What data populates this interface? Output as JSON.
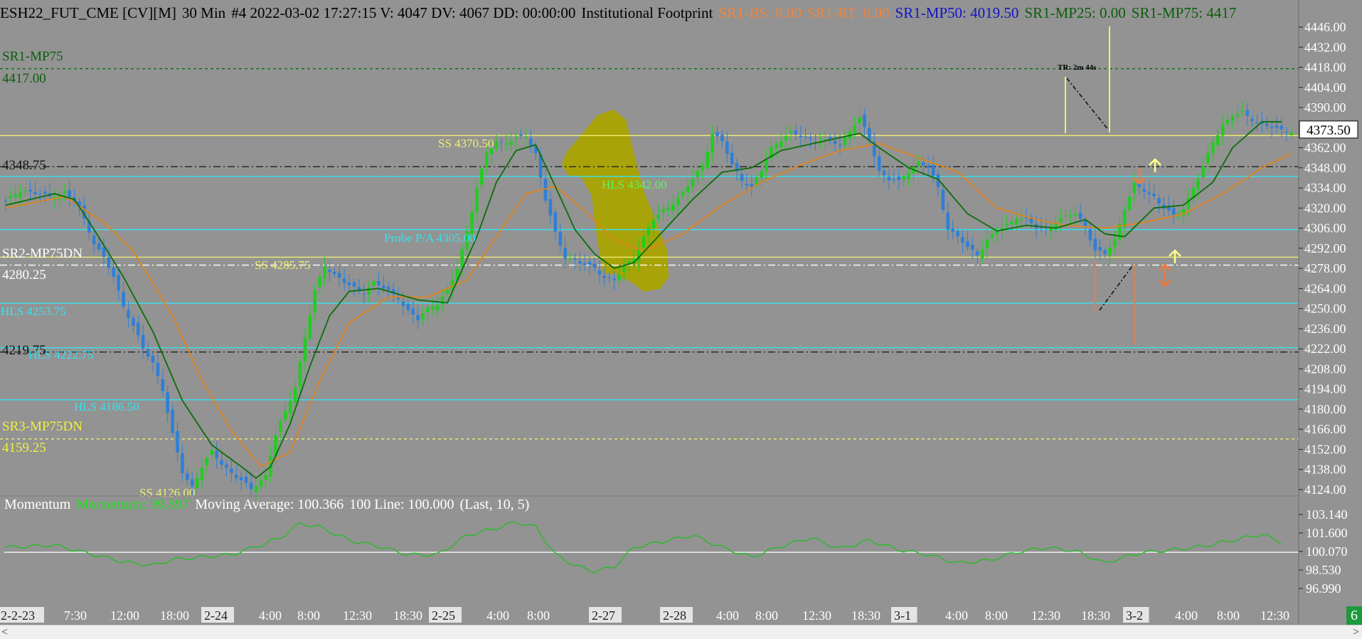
{
  "header": {
    "symbol": "ESH22_FUT_CME [CV][M]",
    "interval": "30 Min",
    "bar_info": "#4 2022-03-02 17:27:15 V: 4047 DV: 4067 DD: 00:00:00",
    "study": "Institutional Footprint",
    "sr1_bs": "SR1-BS: 0.00",
    "sr1_rt": "SR1-RT: 0.00",
    "sr1_mp50": "SR1-MP50: 4019.50",
    "sr1_mp25": "SR1-MP25: 0.00",
    "sr1_mp75": "SR1-MP75: 4417"
  },
  "colors": {
    "background": "#939393",
    "candle_up": "#22cc22",
    "candle_down": "#2f7fd6",
    "fast_ma": "#0b6e0b",
    "slow_ma": "#e0841c",
    "cyan_line": "#35e3f0",
    "yellow_line": "#f0f070",
    "highlight": "#a9a300",
    "orange_arrow": "#f07a3a",
    "yellow_arrow": "#ffff8a",
    "momentum_line": "#1fbf1f"
  },
  "price_axis": {
    "ticks": [
      "4446.00",
      "4432.00",
      "4418.00",
      "4404.00",
      "4390.00",
      "4376.00",
      "4362.00",
      "4348.00",
      "4334.00",
      "4320.00",
      "4306.00",
      "4292.00",
      "4278.00",
      "4264.00",
      "4250.00",
      "4236.00",
      "4222.00",
      "4208.00",
      "4194.00",
      "4180.00",
      "4166.00",
      "4152.00",
      "4138.00",
      "4124.00"
    ],
    "current": "4373.50"
  },
  "momentum_axis": {
    "ticks": [
      "103.140",
      "101.600",
      "100.070",
      "98.530",
      "96.990"
    ]
  },
  "time_axis": {
    "labels": [
      {
        "t": "2-2-23",
        "sep": true
      },
      {
        "t": "7:30"
      },
      {
        "t": "12:00"
      },
      {
        "t": "18:00"
      },
      {
        "t": "2-24",
        "sep": true
      },
      {
        "t": "4:00"
      },
      {
        "t": "8:00"
      },
      {
        "t": "12:30"
      },
      {
        "t": "18:30"
      },
      {
        "t": "2-25",
        "sep": true
      },
      {
        "t": "4:00"
      },
      {
        "t": "8:00"
      },
      {
        "t": "2-27",
        "sep": true
      },
      {
        "t": "2-28",
        "sep": true
      },
      {
        "t": "4:00"
      },
      {
        "t": "8:00"
      },
      {
        "t": "12:30"
      },
      {
        "t": "18:30"
      },
      {
        "t": "3-1",
        "sep": true
      },
      {
        "t": "4:00"
      },
      {
        "t": "8:00"
      },
      {
        "t": "12:30"
      },
      {
        "t": "18:30"
      },
      {
        "t": "3-2",
        "sep": true
      },
      {
        "t": "4:00"
      },
      {
        "t": "8:00"
      },
      {
        "t": "12:30"
      }
    ]
  },
  "level_labels": {
    "sr1_name": "SR1-MP75",
    "sr1_value": "4417.00",
    "pivot_value": "4348.75",
    "sr2_name": "SR2-MP75DN",
    "sr2_value": "4280.25",
    "low_pivot": "4219.75",
    "sr3_name": "SR3-MP75DN",
    "sr3_value": "4159.25",
    "ss1": "SS 4370.50",
    "hls_mid": "HLS 4342.00",
    "probe": "Probe P/A 4305.00",
    "ss2": "SS 4285.75",
    "hls1": "HLS 4253.75",
    "hls2": "HLS 4222.75",
    "hls3": "HLS 4186.50",
    "ss3": "SS 4126.00",
    "tr": "TR: 2m 44s"
  },
  "momentum": {
    "name": "Momentum",
    "value": "Momentum: 99.897",
    "ma": "Moving Average: 100.366",
    "line100": "100 Line: 100.000",
    "params": "(Last, 10, 5)"
  },
  "corner_badge": "6",
  "chart_data": {
    "type": "candlestick",
    "title": "ESH22_FUT_CME [CV][M] 30 Min",
    "ylim": [
      4124,
      4446
    ],
    "anchors": [
      [
        0,
        4324
      ],
      [
        3,
        4333
      ],
      [
        6,
        4330
      ],
      [
        9,
        4328
      ],
      [
        12,
        4331
      ],
      [
        15,
        4320
      ],
      [
        18,
        4296
      ],
      [
        20,
        4285
      ],
      [
        22,
        4272
      ],
      [
        24,
        4252
      ],
      [
        26,
        4238
      ],
      [
        28,
        4222
      ],
      [
        30,
        4212
      ],
      [
        32,
        4194
      ],
      [
        34,
        4162
      ],
      [
        36,
        4136
      ],
      [
        38,
        4126
      ],
      [
        40,
        4140
      ],
      [
        42,
        4150
      ],
      [
        44,
        4142
      ],
      [
        46,
        4136
      ],
      [
        48,
        4130
      ],
      [
        50,
        4124
      ],
      [
        53,
        4134
      ],
      [
        55,
        4162
      ],
      [
        57,
        4178
      ],
      [
        59,
        4196
      ],
      [
        61,
        4230
      ],
      [
        63,
        4262
      ],
      [
        65,
        4280
      ],
      [
        67,
        4274
      ],
      [
        69,
        4268
      ],
      [
        71,
        4264
      ],
      [
        73,
        4262
      ],
      [
        75,
        4268
      ],
      [
        78,
        4262
      ],
      [
        80,
        4258
      ],
      [
        82,
        4248
      ],
      [
        84,
        4242
      ],
      [
        86,
        4250
      ],
      [
        88,
        4254
      ],
      [
        90,
        4262
      ],
      [
        92,
        4278
      ],
      [
        94,
        4304
      ],
      [
        96,
        4334
      ],
      [
        98,
        4358
      ],
      [
        100,
        4366
      ],
      [
        102,
        4366
      ],
      [
        104,
        4368
      ],
      [
        106,
        4370
      ],
      [
        108,
        4358
      ],
      [
        110,
        4326
      ],
      [
        112,
        4302
      ],
      [
        114,
        4286
      ],
      [
        116,
        4284
      ],
      [
        118,
        4280
      ],
      [
        120,
        4278
      ],
      [
        122,
        4272
      ],
      [
        124,
        4270
      ],
      [
        126,
        4278
      ],
      [
        128,
        4286
      ],
      [
        130,
        4300
      ],
      [
        132,
        4312
      ],
      [
        134,
        4318
      ],
      [
        136,
        4324
      ],
      [
        138,
        4330
      ],
      [
        140,
        4340
      ],
      [
        142,
        4350
      ],
      [
        144,
        4372
      ],
      [
        146,
        4366
      ],
      [
        148,
        4350
      ],
      [
        150,
        4340
      ],
      [
        152,
        4334
      ],
      [
        154,
        4346
      ],
      [
        156,
        4362
      ],
      [
        158,
        4368
      ],
      [
        160,
        4372
      ],
      [
        162,
        4370
      ],
      [
        164,
        4368
      ],
      [
        166,
        4366
      ],
      [
        168,
        4367
      ],
      [
        170,
        4364
      ],
      [
        172,
        4374
      ],
      [
        174,
        4382
      ],
      [
        176,
        4368
      ],
      [
        178,
        4346
      ],
      [
        180,
        4340
      ],
      [
        182,
        4338
      ],
      [
        184,
        4346
      ],
      [
        186,
        4352
      ],
      [
        188,
        4348
      ],
      [
        190,
        4334
      ],
      [
        192,
        4306
      ],
      [
        194,
        4300
      ],
      [
        196,
        4292
      ],
      [
        198,
        4288
      ],
      [
        200,
        4298
      ],
      [
        202,
        4304
      ],
      [
        204,
        4308
      ],
      [
        206,
        4314
      ],
      [
        208,
        4312
      ],
      [
        210,
        4306
      ],
      [
        212,
        4306
      ],
      [
        214,
        4310
      ],
      [
        216,
        4314
      ],
      [
        218,
        4316
      ],
      [
        220,
        4308
      ],
      [
        222,
        4290
      ],
      [
        224,
        4288
      ],
      [
        226,
        4298
      ],
      [
        228,
        4320
      ],
      [
        230,
        4336
      ],
      [
        232,
        4332
      ],
      [
        234,
        4328
      ],
      [
        236,
        4320
      ],
      [
        238,
        4314
      ],
      [
        240,
        4320
      ],
      [
        242,
        4334
      ],
      [
        244,
        4348
      ],
      [
        246,
        4366
      ],
      [
        248,
        4378
      ],
      [
        250,
        4384
      ],
      [
        252,
        4386
      ],
      [
        254,
        4382
      ],
      [
        256,
        4378
      ],
      [
        258,
        4376
      ],
      [
        260,
        4374
      ]
    ],
    "fast_ma_anchors": [
      [
        0,
        4322
      ],
      [
        10,
        4330
      ],
      [
        14,
        4326
      ],
      [
        18,
        4305
      ],
      [
        24,
        4272
      ],
      [
        30,
        4234
      ],
      [
        36,
        4186
      ],
      [
        42,
        4155
      ],
      [
        48,
        4140
      ],
      [
        51,
        4132
      ],
      [
        54,
        4140
      ],
      [
        58,
        4170
      ],
      [
        62,
        4210
      ],
      [
        66,
        4245
      ],
      [
        70,
        4262
      ],
      [
        76,
        4264
      ],
      [
        84,
        4256
      ],
      [
        90,
        4254
      ],
      [
        96,
        4300
      ],
      [
        100,
        4338
      ],
      [
        104,
        4360
      ],
      [
        108,
        4364
      ],
      [
        112,
        4335
      ],
      [
        116,
        4305
      ],
      [
        120,
        4288
      ],
      [
        124,
        4278
      ],
      [
        128,
        4282
      ],
      [
        134,
        4304
      ],
      [
        140,
        4326
      ],
      [
        146,
        4345
      ],
      [
        152,
        4348
      ],
      [
        158,
        4360
      ],
      [
        166,
        4366
      ],
      [
        174,
        4372
      ],
      [
        178,
        4362
      ],
      [
        184,
        4348
      ],
      [
        190,
        4340
      ],
      [
        196,
        4316
      ],
      [
        202,
        4304
      ],
      [
        208,
        4308
      ],
      [
        214,
        4306
      ],
      [
        220,
        4312
      ],
      [
        224,
        4302
      ],
      [
        228,
        4300
      ],
      [
        234,
        4320
      ],
      [
        240,
        4322
      ],
      [
        246,
        4338
      ],
      [
        250,
        4362
      ],
      [
        256,
        4380
      ],
      [
        260,
        4380
      ]
    ],
    "slow_ma_anchors": [
      [
        0,
        4320
      ],
      [
        12,
        4328
      ],
      [
        20,
        4310
      ],
      [
        26,
        4290
      ],
      [
        34,
        4245
      ],
      [
        40,
        4200
      ],
      [
        46,
        4165
      ],
      [
        52,
        4140
      ],
      [
        58,
        4150
      ],
      [
        64,
        4200
      ],
      [
        70,
        4240
      ],
      [
        78,
        4258
      ],
      [
        86,
        4258
      ],
      [
        94,
        4270
      ],
      [
        100,
        4300
      ],
      [
        106,
        4330
      ],
      [
        112,
        4335
      ],
      [
        118,
        4318
      ],
      [
        124,
        4298
      ],
      [
        130,
        4290
      ],
      [
        138,
        4302
      ],
      [
        146,
        4322
      ],
      [
        154,
        4338
      ],
      [
        162,
        4350
      ],
      [
        170,
        4360
      ],
      [
        178,
        4365
      ],
      [
        186,
        4355
      ],
      [
        194,
        4345
      ],
      [
        202,
        4320
      ],
      [
        210,
        4312
      ],
      [
        216,
        4308
      ],
      [
        224,
        4306
      ],
      [
        232,
        4310
      ],
      [
        240,
        4316
      ],
      [
        248,
        4330
      ],
      [
        256,
        4348
      ],
      [
        262,
        4358
      ]
    ],
    "horizontal_levels": [
      {
        "price": 4417.0,
        "style": "dash",
        "color": "#0b6e0b"
      },
      {
        "price": 4370.5,
        "style": "solid",
        "color": "#f0f070"
      },
      {
        "price": 4348.75,
        "style": "dashdot",
        "color": "#222222"
      },
      {
        "price": 4342.0,
        "style": "solid",
        "color": "#35e3f0"
      },
      {
        "price": 4305.0,
        "style": "solid",
        "color": "#35e3f0"
      },
      {
        "price": 4285.75,
        "style": "solid",
        "color": "#f0f070"
      },
      {
        "price": 4280.25,
        "style": "dashdot",
        "color": "#ffffff"
      },
      {
        "price": 4253.75,
        "style": "solid",
        "color": "#35e3f0"
      },
      {
        "price": 4222.75,
        "style": "solid",
        "color": "#35e3f0"
      },
      {
        "price": 4219.75,
        "style": "dashdot",
        "color": "#222222"
      },
      {
        "price": 4186.5,
        "style": "solid",
        "color": "#35e3f0"
      },
      {
        "price": 4159.25,
        "style": "dash",
        "color": "#f0f070"
      }
    ],
    "momentum_ylim": [
      96.99,
      103.14
    ],
    "momentum_anchors": [
      [
        0,
        100.4
      ],
      [
        10,
        100.6
      ],
      [
        18,
        99.8
      ],
      [
        24,
        99.2
      ],
      [
        30,
        98.9
      ],
      [
        34,
        99.4
      ],
      [
        40,
        99.6
      ],
      [
        46,
        99.8
      ],
      [
        52,
        100.6
      ],
      [
        56,
        101.2
      ],
      [
        60,
        102.4
      ],
      [
        64,
        102.1
      ],
      [
        70,
        101.0
      ],
      [
        76,
        100.5
      ],
      [
        82,
        99.8
      ],
      [
        88,
        99.8
      ],
      [
        94,
        101.4
      ],
      [
        100,
        102.0
      ],
      [
        104,
        102.5
      ],
      [
        108,
        102.1
      ],
      [
        112,
        99.8
      ],
      [
        116,
        98.9
      ],
      [
        120,
        98.4
      ],
      [
        124,
        98.8
      ],
      [
        128,
        100.4
      ],
      [
        134,
        100.9
      ],
      [
        140,
        101.4
      ],
      [
        146,
        100.4
      ],
      [
        152,
        99.6
      ],
      [
        158,
        100.5
      ],
      [
        164,
        101.2
      ],
      [
        170,
        100.3
      ],
      [
        176,
        101.0
      ],
      [
        182,
        100.2
      ],
      [
        188,
        99.8
      ],
      [
        194,
        99.1
      ],
      [
        200,
        99.3
      ],
      [
        206,
        100.0
      ],
      [
        212,
        100.4
      ],
      [
        218,
        100.1
      ],
      [
        224,
        99.1
      ],
      [
        228,
        99.6
      ],
      [
        232,
        100.0
      ],
      [
        238,
        100.2
      ],
      [
        244,
        100.5
      ],
      [
        250,
        101.0
      ],
      [
        256,
        101.5
      ],
      [
        260,
        100.8
      ]
    ]
  }
}
